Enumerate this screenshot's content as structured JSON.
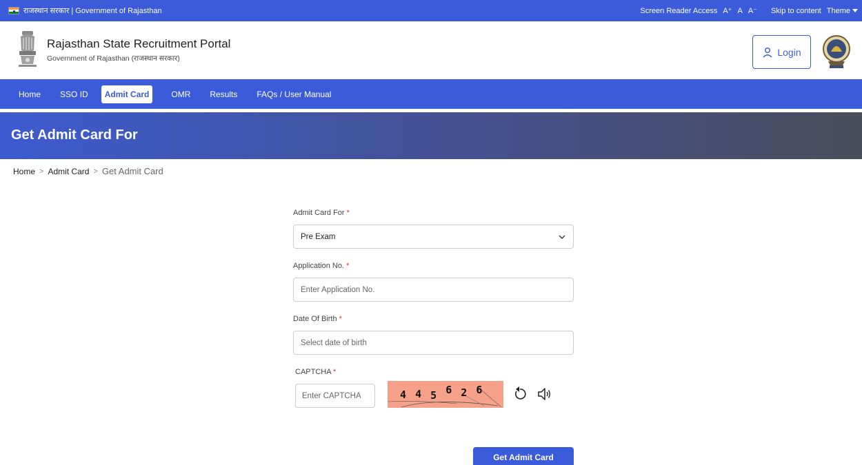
{
  "topbar": {
    "gov_label": "राजस्थान सरकार | Government of Rajasthan",
    "screen_reader": "Screen Reader Access",
    "font_increase": "A⁺",
    "font_normal": "A",
    "font_decrease": "A⁻",
    "skip": "Skip to content",
    "theme": "Theme"
  },
  "header": {
    "title": "Rajasthan State Recruitment Portal",
    "subtitle": "Government of Rajasthan (राजस्थान सरकार)",
    "login_label": "Login"
  },
  "nav": {
    "items": [
      "Home",
      "SSO ID",
      "Admit Card",
      "OMR",
      "Results",
      "FAQs / User Manual"
    ],
    "active": "Admit Card"
  },
  "banner": {
    "title": "Get Admit Card For"
  },
  "breadcrumb": {
    "items": [
      "Home",
      "Admit Card",
      "Get Admit Card"
    ],
    "separator": ">"
  },
  "form": {
    "admit_for_label": "Admit Card For",
    "admit_for_value": "Pre Exam",
    "app_no_label": "Application No.",
    "app_no_placeholder": "Enter Application No.",
    "dob_label": "Date Of Birth",
    "dob_placeholder": "Select date of birth",
    "captcha_label": "CAPTCHA",
    "captcha_placeholder": "Enter CAPTCHA",
    "captcha_digits": [
      "4",
      "4",
      "5",
      "6",
      "2",
      "6"
    ],
    "required_mark": "*",
    "submit_label": "Get Admit Card"
  },
  "colors": {
    "primary": "#3b5bdb",
    "required": "#e03131",
    "captcha_bg": "#f7a08a"
  }
}
